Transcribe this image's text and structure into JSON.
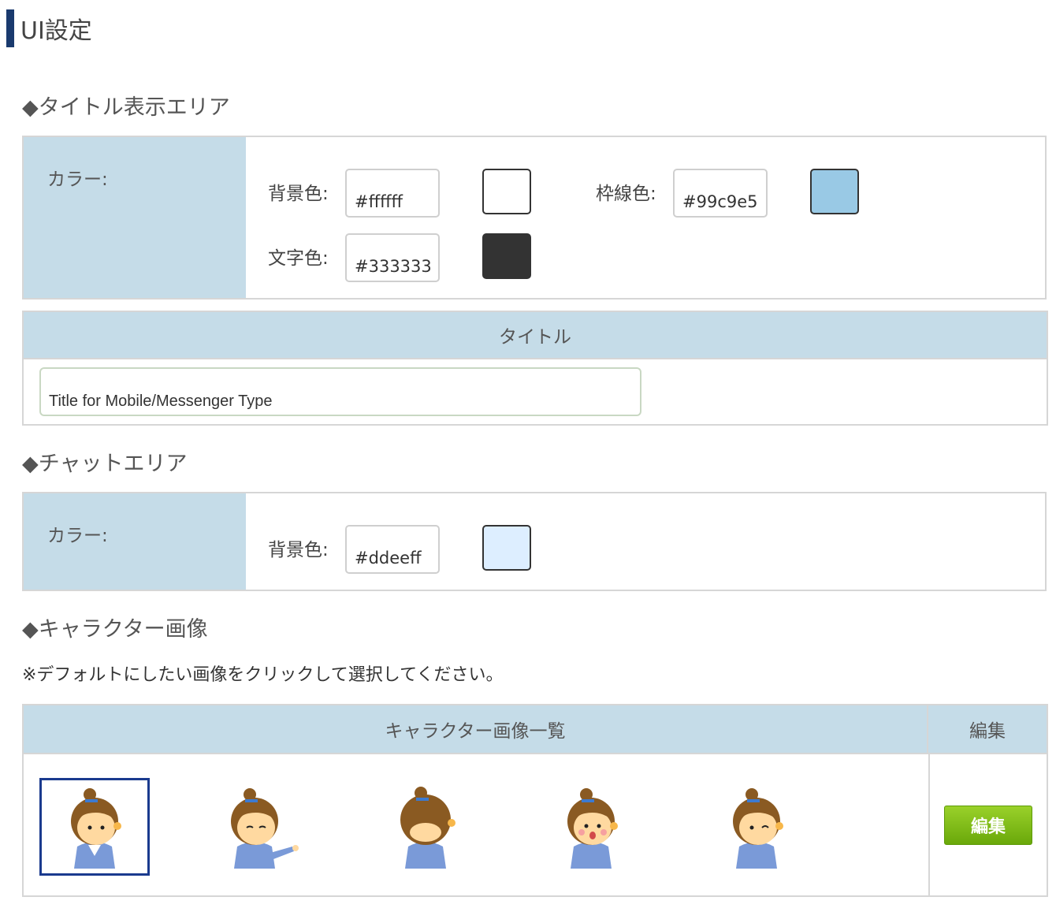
{
  "page": {
    "title": "UI設定"
  },
  "title_area": {
    "heading": "◆タイトル表示エリア",
    "color_label": "カラー:",
    "bg_label": "背景色:",
    "bg_value": "#ffffff",
    "border_label": "枠線色:",
    "border_value": "#99c9e5",
    "text_label": "文字色:",
    "text_value": "#333333",
    "title_header": "タイトル",
    "title_value": "Title for Mobile/Messenger Type"
  },
  "chat_area": {
    "heading": "◆チャットエリア",
    "color_label": "カラー:",
    "bg_label": "背景色:",
    "bg_value": "#ddeeff"
  },
  "character": {
    "heading": "◆キャラクター画像",
    "note": "※デフォルトにしたい画像をクリックして選択してください。",
    "list_header": "キャラクター画像一覧",
    "edit_header": "編集",
    "edit_button": "編集",
    "images": [
      {
        "pose": "neutral",
        "selected": true
      },
      {
        "pose": "pointing",
        "selected": false
      },
      {
        "pose": "bowing",
        "selected": false
      },
      {
        "pose": "surprised",
        "selected": false
      },
      {
        "pose": "smiling",
        "selected": false
      }
    ]
  }
}
